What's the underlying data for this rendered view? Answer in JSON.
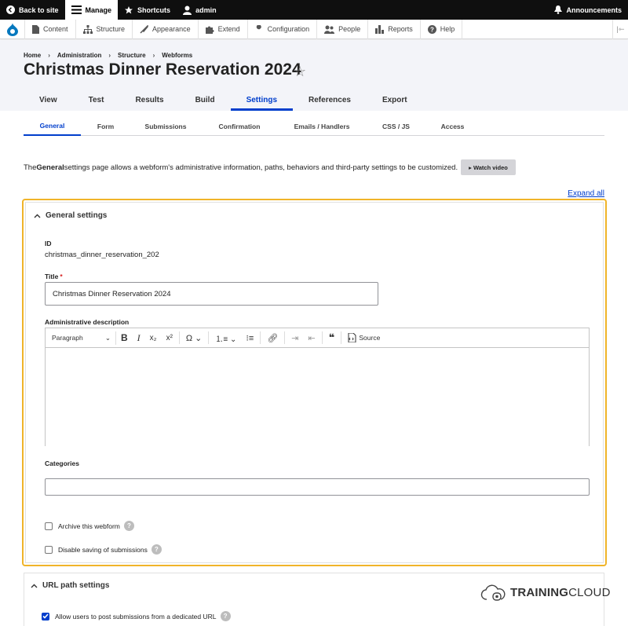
{
  "toolbar_top": {
    "back": "Back to site",
    "manage": "Manage",
    "shortcuts": "Shortcuts",
    "user": "admin",
    "announcements": "Announcements"
  },
  "toolbar_secondary": {
    "items": [
      "Content",
      "Structure",
      "Appearance",
      "Extend",
      "Configuration",
      "People",
      "Reports",
      "Help"
    ]
  },
  "breadcrumb": [
    "Home",
    "Administration",
    "Structure",
    "Webforms"
  ],
  "page_title": "Christmas Dinner Reservation 2024",
  "primary_tabs": [
    "View",
    "Test",
    "Results",
    "Build",
    "Settings",
    "References",
    "Export"
  ],
  "primary_active": "Settings",
  "secondary_tabs": [
    "General",
    "Form",
    "Submissions",
    "Confirmation",
    "Emails / Handlers",
    "CSS / JS",
    "Access"
  ],
  "secondary_active": "General",
  "intro": {
    "pre": "The ",
    "bold": "General",
    "post": " settings page allows a webform's administrative information, paths, behaviors and third-party settings to be customized.",
    "watch_video": "▸ Watch video"
  },
  "expand_all": "Expand all",
  "general_settings": {
    "summary": "General settings",
    "id_label": "ID",
    "id_value": "christmas_dinner_reservation_202",
    "title_label": "Title",
    "title_value": "Christmas Dinner Reservation 2024",
    "admin_desc_label": "Administrative description",
    "editor": {
      "paragraph": "Paragraph",
      "source": "Source"
    },
    "categories_label": "Categories",
    "archive_label": "Archive this webform",
    "disable_saving_label": "Disable saving of submissions"
  },
  "url_path": {
    "summary": "URL path settings",
    "allow_label": "Allow users to post submissions from a dedicated URL",
    "allow_checked": true
  },
  "brand": {
    "bold": "TRAINING",
    "light": "CLOUD"
  },
  "colors": {
    "accent": "#003ecc",
    "focus_outline": "#f0b429",
    "toolbar_bg": "#0f0f0f"
  }
}
